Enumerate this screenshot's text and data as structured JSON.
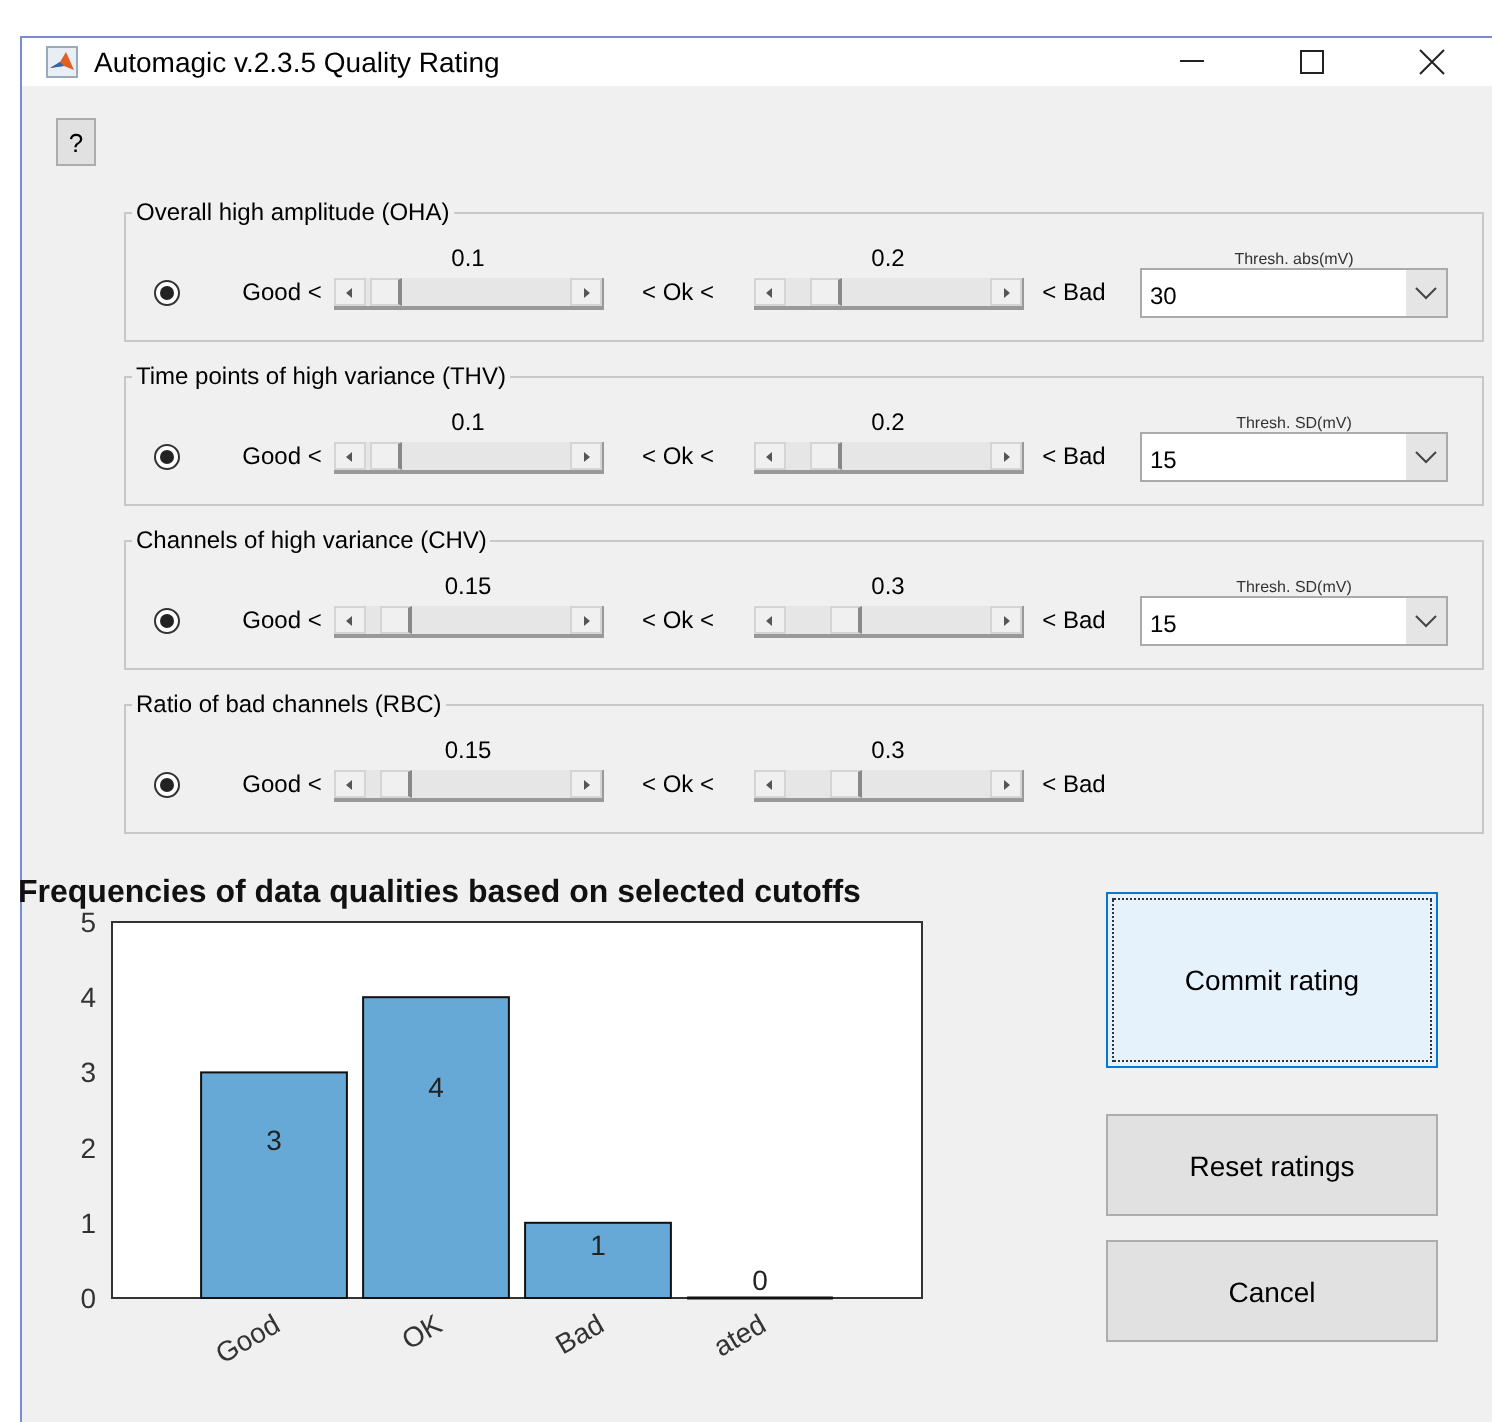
{
  "window": {
    "title": "Automagic v.2.3.5 Quality Rating"
  },
  "help_button": "?",
  "panels": [
    {
      "title": "Overall high amplitude (OHA)",
      "selected": true,
      "good_label": "Good <",
      "ok_label": "< Ok <",
      "bad_label": "< Bad",
      "sliders": [
        {
          "value": "0.1",
          "level": 0.1
        },
        {
          "value": "0.2",
          "level": 0.2
        }
      ],
      "threshold": {
        "caption": "Thresh. abs(mV)",
        "value": "30"
      }
    },
    {
      "title": "Time points of high variance (THV)",
      "selected": true,
      "good_label": "Good <",
      "ok_label": "< Ok <",
      "bad_label": "< Bad",
      "sliders": [
        {
          "value": "0.1",
          "level": 0.1
        },
        {
          "value": "0.2",
          "level": 0.2
        }
      ],
      "threshold": {
        "caption": "Thresh. SD(mV)",
        "value": "15"
      }
    },
    {
      "title": "Channels of high variance (CHV)",
      "selected": true,
      "good_label": "Good <",
      "ok_label": "< Ok <",
      "bad_label": "< Bad",
      "sliders": [
        {
          "value": "0.15",
          "level": 0.15
        },
        {
          "value": "0.3",
          "level": 0.3
        }
      ],
      "threshold": {
        "caption": "Thresh. SD(mV)",
        "value": "15"
      }
    },
    {
      "title": "Ratio of bad channels (RBC)",
      "selected": true,
      "good_label": "Good <",
      "ok_label": "< Ok <",
      "bad_label": "< Bad",
      "sliders": [
        {
          "value": "0.15",
          "level": 0.15
        },
        {
          "value": "0.3",
          "level": 0.3
        }
      ]
    }
  ],
  "chart": {
    "chart_data": {
      "type": "bar",
      "title": "Frequencies of data qualities based on selected cutoffs",
      "categories": [
        "Good",
        "OK",
        "Bad",
        "ated"
      ],
      "values": [
        3,
        4,
        1,
        0
      ],
      "ylim": [
        0,
        5
      ],
      "yticks": [
        0,
        1,
        2,
        3,
        4,
        5
      ],
      "data_labels": true
    }
  },
  "buttons": [
    {
      "label": "Commit rating",
      "focused": true
    },
    {
      "label": "Reset ratings",
      "focused": false
    },
    {
      "label": "Cancel",
      "focused": false
    }
  ]
}
